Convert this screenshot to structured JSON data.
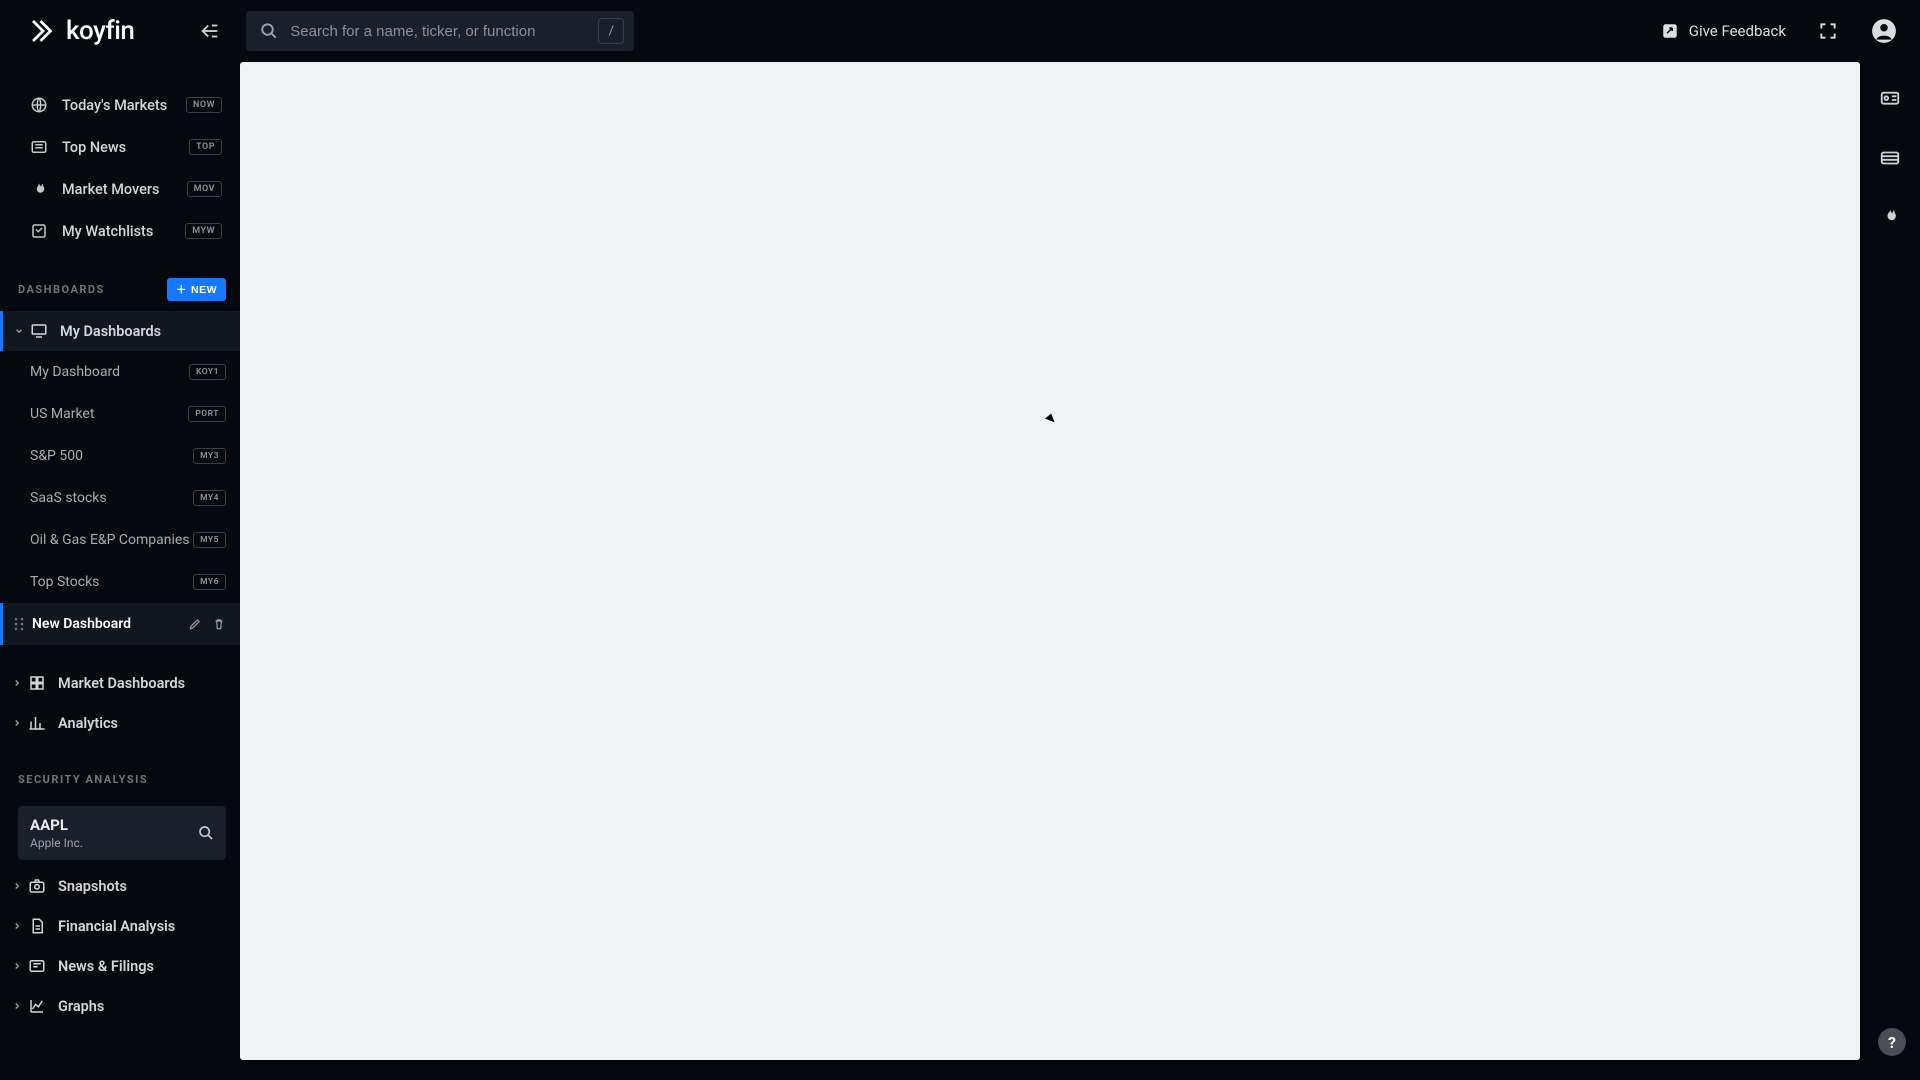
{
  "app": {
    "name": "koyfin"
  },
  "search": {
    "placeholder": "Search for a name, ticker, or function",
    "shortcut": "/"
  },
  "header": {
    "feedback": "Give Feedback"
  },
  "sidebar": {
    "nav": [
      {
        "label": "Today's Markets",
        "badge": "NOW"
      },
      {
        "label": "Top News",
        "badge": "TOP"
      },
      {
        "label": "Market Movers",
        "badge": "MOV"
      },
      {
        "label": "My Watchlists",
        "badge": "MYW"
      }
    ],
    "dashboards_section": "DASHBOARDS",
    "new_button": "NEW",
    "my_dashboards_label": "My Dashboards",
    "dashboards": [
      {
        "label": "My Dashboard",
        "badge": "KOY1"
      },
      {
        "label": "US Market",
        "badge": "PORT"
      },
      {
        "label": "S&P 500",
        "badge": "MY3"
      },
      {
        "label": "SaaS stocks",
        "badge": "MY4"
      },
      {
        "label": "Oil & Gas E&P Companies",
        "badge": "MY5"
      },
      {
        "label": "Top Stocks",
        "badge": "MY6"
      },
      {
        "label": "New Dashboard",
        "badge": "",
        "active": true
      }
    ],
    "market_dashboards_label": "Market Dashboards",
    "analytics_label": "Analytics",
    "security_section": "SECURITY ANALYSIS",
    "security": {
      "ticker": "AAPL",
      "name": "Apple Inc."
    },
    "security_items": [
      {
        "label": "Snapshots"
      },
      {
        "label": "Financial Analysis"
      },
      {
        "label": "News & Filings"
      },
      {
        "label": "Graphs"
      }
    ]
  }
}
